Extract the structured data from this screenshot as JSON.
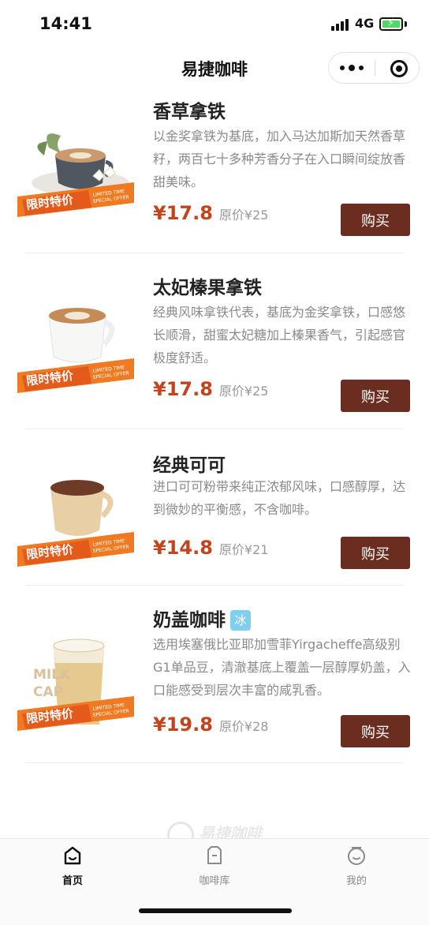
{
  "status_bar": {
    "time": "14:41",
    "network": "4G"
  },
  "nav": {
    "title": "易捷咖啡"
  },
  "colors": {
    "accent": "#c2451e",
    "button": "#6b2d1f",
    "badge_orange": "#f07a22",
    "ice_badge": "#7fd0f0"
  },
  "badge": {
    "main": "限时特价",
    "sub1": "LIMITED TIME",
    "sub2": "SPECIAL OFFER"
  },
  "products": [
    {
      "name": "香草拿铁",
      "desc": "以金奖拿铁为基底，加入马达加斯加天然香草籽，两百七十多种芳香分子在入口瞬间绽放香甜美味。",
      "price": "¥17.8",
      "orig_price": "原价¥25",
      "buy": "购买"
    },
    {
      "name": "太妃榛果拿铁",
      "desc": "经典风味拿铁代表，基底为金奖拿铁，口感悠长顺滑，甜蜜太妃糖加上榛果香气，引起感官极度舒适。",
      "price": "¥17.8",
      "orig_price": "原价¥25",
      "buy": "购买"
    },
    {
      "name": "经典可可",
      "desc": "进口可可粉带来纯正浓郁风味，口感醇厚，达到微妙的平衡感，不含咖啡。",
      "price": "¥14.8",
      "orig_price": "原价¥21",
      "buy": "购买"
    },
    {
      "name": "奶盖咖啡",
      "tag": "冰",
      "img_text1": "MILK",
      "img_text2": "CAP",
      "desc": "选用埃塞俄比亚耶加雪菲Yirgacheffe高级别G1单品豆，清澈基底上覆盖一层醇厚奶盖，入口能感受到层次丰富的咸乳香。",
      "price": "¥19.8",
      "orig_price": "原价¥28",
      "buy": "购买"
    }
  ],
  "footer": {
    "watermark": "易捷咖啡"
  },
  "tabs": [
    {
      "label": "首页",
      "icon": "home-icon",
      "active": true
    },
    {
      "label": "咖啡库",
      "icon": "coffee-library-icon",
      "active": false
    },
    {
      "label": "我的",
      "icon": "profile-icon",
      "active": false
    }
  ]
}
